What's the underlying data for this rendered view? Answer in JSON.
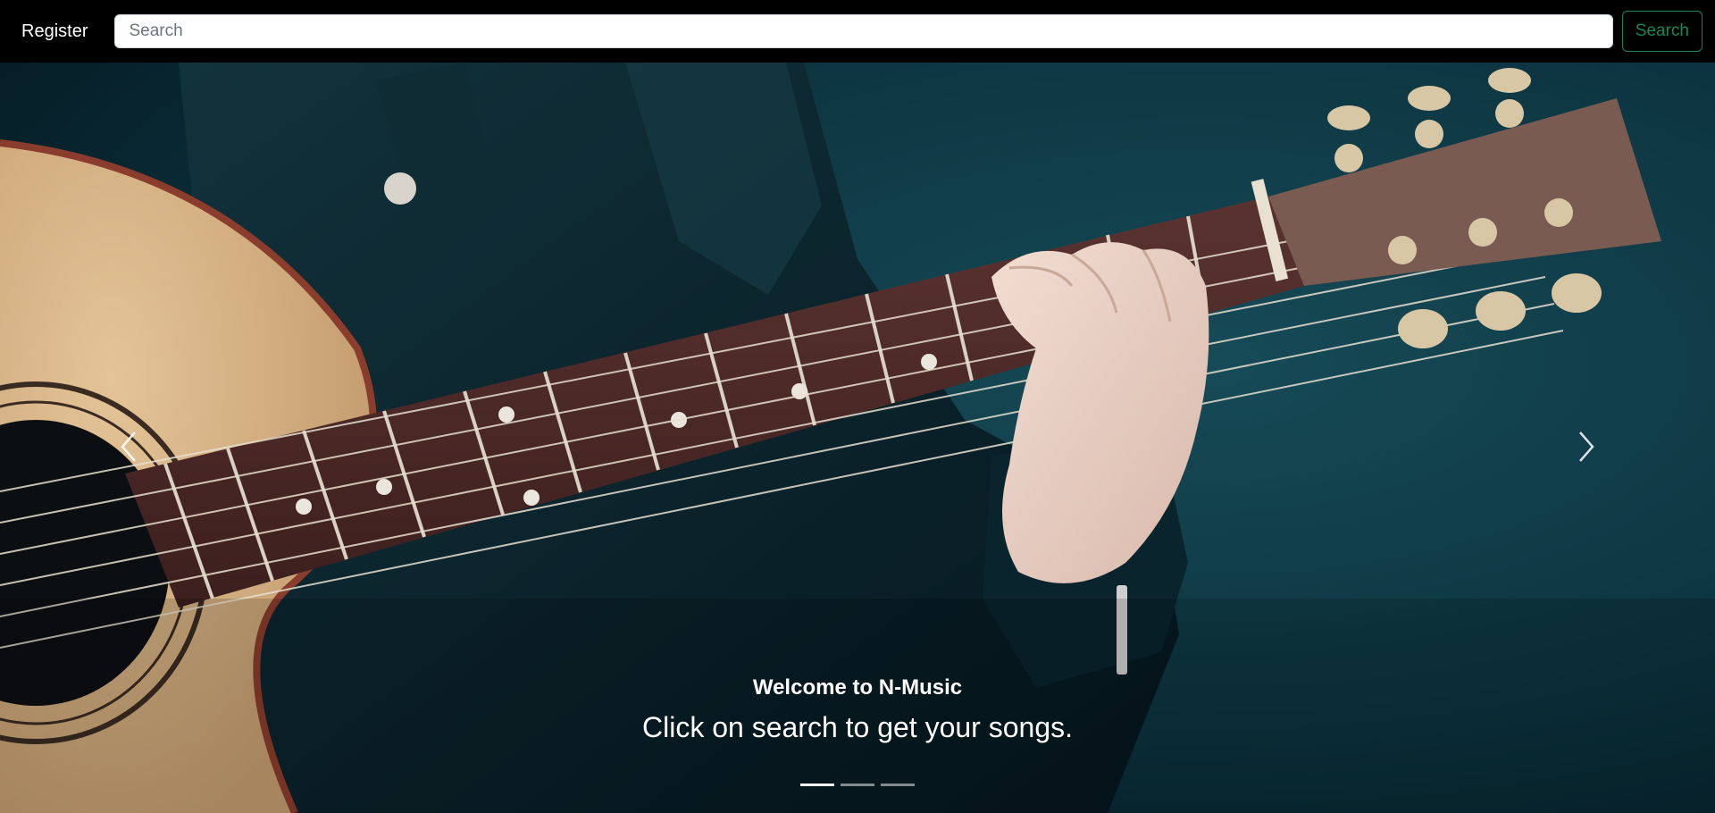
{
  "navbar": {
    "register_label": "Register",
    "search_placeholder": "Search",
    "search_value": "",
    "search_button_label": "Search"
  },
  "carousel": {
    "active_slide": 1,
    "slide_count": 3,
    "caption_title": "Welcome to N-Music",
    "caption_text": "Click on search to get your songs.",
    "prev_icon": "chevron-left-icon",
    "next_icon": "chevron-right-icon"
  },
  "colors": {
    "navbar_bg": "#000000",
    "search_button": "#198754",
    "backdrop": "#0d3a45"
  }
}
